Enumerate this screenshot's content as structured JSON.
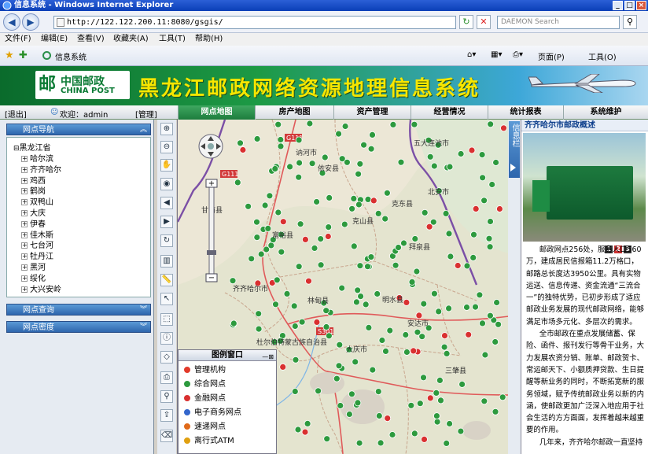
{
  "window": {
    "title": "信息系统 - Windows Internet Explorer"
  },
  "address": {
    "url": "http://122.122.200.11:8080/gsgis/",
    "search_placeholder": "DAEMON Search"
  },
  "menu": [
    "文件(F)",
    "编辑(E)",
    "查看(V)",
    "收藏夹(A)",
    "工具(T)",
    "帮助(H)"
  ],
  "tab": {
    "title": "信息系统"
  },
  "toolbar_right": {
    "page": "页面(P)",
    "tools": "工具(O)"
  },
  "banner": {
    "logo_cn": "中国邮政",
    "logo_en": "CHINA POST",
    "title": "黑龙江邮政网络资源地理信息系统"
  },
  "userbar": {
    "exit": "[退出]",
    "welcome": "欢迎：admin",
    "manage": "[管理]"
  },
  "nav_tabs": [
    "网点地图",
    "房产地图",
    "资产管理",
    "经营情况",
    "统计报表",
    "系统维护"
  ],
  "left": {
    "section1": "网点导航",
    "tree_root": "黑龙江省",
    "tree_children": [
      "哈尔滨",
      "齐齐哈尔",
      "鸡西",
      "鹤岗",
      "双鸭山",
      "大庆",
      "伊春",
      "佳木斯",
      "七台河",
      "牡丹江",
      "黑河",
      "绥化",
      "大兴安岭"
    ],
    "section2": "网点查询",
    "section3": "网点密度"
  },
  "map": {
    "labels": [
      "五大连池市",
      "北安市",
      "克东县",
      "拜泉县",
      "明水县",
      "依安县",
      "富裕县",
      "讷河市",
      "克山县",
      "齐齐哈尔市",
      "杜尔伯特蒙古族自治县",
      "林甸县",
      "大庆市",
      "安达市",
      "三肇县",
      "甘南县"
    ],
    "road_labels": [
      "G111",
      "G111",
      "S301"
    ],
    "legend_title": "图例窗口",
    "legend_ctrl": "—⊠",
    "legend_items": [
      {
        "label": "管理机构",
        "color": "#e23a2a"
      },
      {
        "label": "综合网点",
        "color": "#2d9a3e"
      },
      {
        "label": "金融网点",
        "color": "#d93030"
      },
      {
        "label": "电子商务网点",
        "color": "#3366cc"
      },
      {
        "label": "速递网点",
        "color": "#e06a1a"
      },
      {
        "label": "离行式ATM",
        "color": "#e0a010"
      }
    ]
  },
  "info": {
    "tab_label": "信息栏",
    "heading": "齐齐哈尔市邮政概述",
    "photo_pages": [
      "1",
      "2",
      "3"
    ],
    "paragraphs": [
      "邮政网点256处，服务人口560万，建成居民信报箱11.2万格口，邮路总长度达3950公里。具有实物运送、信息传递、资金流通“三流合一”的独特优势，已初步形成了适应邮政业务发展的现代邮政网络，能够满足市场多元化、多层次的需求。",
      "全市邮政在重点发展储蓄、保险、函件、报刊发行等骨干业务，大力发展农资分销、账单、邮政贺卡、常运邮天下、小额质押贷款、生日提醒等新业务的同时，不断拓宽新的服务领域，赋予传统邮政业务以新的内涵，使邮政更加广泛深入地应用于社会生活的方方面面，发挥着越来越重要的作用。",
      "几年来，齐齐哈尔邮政一直坚持"
    ]
  }
}
